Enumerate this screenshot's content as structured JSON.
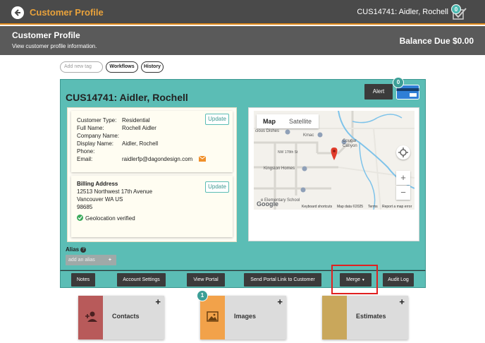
{
  "topbar": {
    "title": "Customer Profile",
    "customer": "CUS14741:  Aidler, Rochell",
    "task_count": "0"
  },
  "header": {
    "title": "Customer Profile",
    "subtitle": "View customer profile information.",
    "balance": "Balance Due $0.00"
  },
  "tags": {
    "placeholder": "Add new tag",
    "workflows": "Workflows",
    "history": "History"
  },
  "panel": {
    "title": "CUS14741: Aidler, Rochell",
    "alert": "Alert",
    "card_count": "0"
  },
  "contact": {
    "labels": [
      "Customer Type:",
      "Full Name:",
      "Company Name:",
      "Display Name:",
      "Phone:",
      "Email:"
    ],
    "values": [
      "Residential",
      "Rochell Aidler",
      "",
      "Aidler, Rochell",
      "",
      "raidlerfp@dagondesign.com"
    ],
    "update": "Update"
  },
  "billing": {
    "title": "Billing Address",
    "line1": "12513 Northwest 17th Avenue",
    "line2": "Vancouver WA US",
    "line3": "98685",
    "geo": "Geolocation verified",
    "update": "Update"
  },
  "map": {
    "tab_map": "Map",
    "tab_satellite": "Satellite",
    "labels": [
      "cious Dishes",
      "Kmac",
      "Cougar",
      "Canyon",
      "NW 178th St",
      "Kingston Homes",
      "e Elementary School",
      "Google"
    ],
    "footer": [
      "Keyboard shortcuts",
      "Map data ©2025",
      "Terms",
      "Report a map error"
    ],
    "zoom_in": "+",
    "zoom_out": "−"
  },
  "alias": {
    "label": "Alias",
    "placeholder": "add an alias",
    "add": "+"
  },
  "buttons": {
    "notes": "Notes",
    "account_settings": "Account Settings",
    "view_portal": "View Portal",
    "send_portal": "Send Portal Link to Customer",
    "merge": "Merge",
    "audit_log": "Audit Log"
  },
  "tiles": {
    "contacts": "Contacts",
    "images": "Images",
    "images_count": "1",
    "estimates": "Estimates",
    "plus": "+"
  },
  "colors": {
    "accent_orange": "#e9a23b",
    "teal": "#5bbdb5",
    "contacts": "#b85a5a",
    "images": "#f2a24a",
    "estimates": "#c9a75b",
    "highlight": "#e02020"
  }
}
